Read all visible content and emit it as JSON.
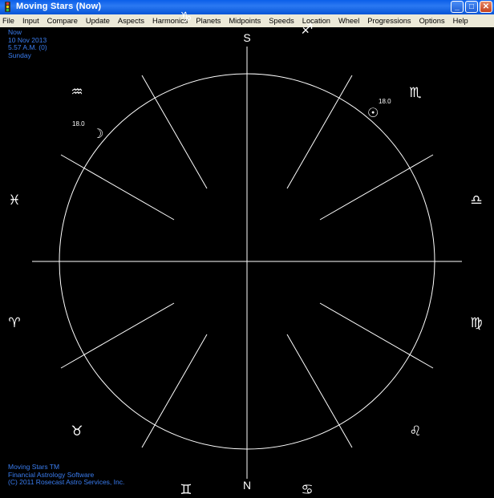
{
  "window": {
    "title": "Moving Stars (Now)",
    "controls": [
      "minimize",
      "maximize",
      "close"
    ]
  },
  "menu": [
    "File",
    "Input",
    "Compare",
    "Update",
    "Aspects",
    "Harmonics",
    "Planets",
    "Midpoints",
    "Speeds",
    "Location",
    "Wheel",
    "Progressions",
    "Options",
    "Help"
  ],
  "chart_info": {
    "label": "Now",
    "date": "10 Nov 2013",
    "time": "5.57 A.M. (0)",
    "weekday": "Sunday"
  },
  "footer": {
    "line1": "Moving Stars TM",
    "line2": "Financial Astrology Software",
    "line3": "(C) 2011 Rosecast Astro Services, Inc."
  },
  "wheel": {
    "top_label": "S",
    "bottom_label": "N",
    "signs": {
      "sagittarius": "♐",
      "scorpio": "♏",
      "libra": "♎",
      "virgo": "♍",
      "leo": "♌",
      "cancer": "♋",
      "gemini": "♊",
      "taurus": "♉",
      "aries": "♈",
      "pisces": "♓",
      "aquarius": "♒",
      "capricorn": "♑"
    },
    "planets": {
      "sun": {
        "glyph": "☉",
        "degree": "18.0"
      },
      "moon": {
        "glyph": "☽",
        "degree": "18.0"
      }
    }
  },
  "colors": {
    "background": "#000000",
    "info_text": "#3a7df0",
    "wheel_lines": "#ffffff",
    "titlebar": "#0a5ee9",
    "menubar": "#ece9d8"
  }
}
